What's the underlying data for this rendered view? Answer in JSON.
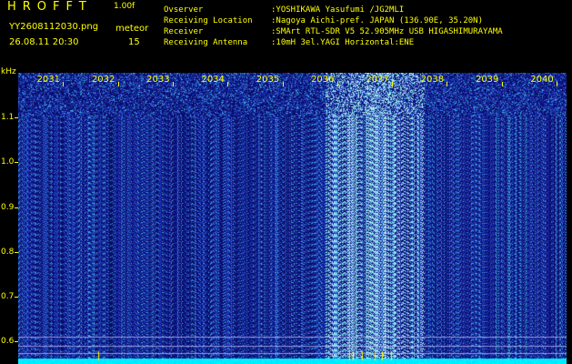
{
  "header": {
    "app_title": "HROFFT",
    "version": "1.00f",
    "filename": "YY2608112030.png",
    "mode": "meteor",
    "datetime": "26.08.11 20:30",
    "count": "15"
  },
  "info": [
    {
      "key": "Ovserver",
      "value": ":YOSHIKAWA Yasufumi /JG2MLI"
    },
    {
      "key": "Receiving Location",
      "value": ":Nagoya Aichi-pref. JAPAN (136.90E, 35.20N)"
    },
    {
      "key": "Receiver",
      "value": ":SMArt RTL-SDR V5 52.905MHz USB HIGASHIMURAYAMA"
    },
    {
      "key": "Receiving Antenna",
      "value": ":10mH 3el.YAGI Horizontal:ENE"
    }
  ],
  "colors": {
    "text": "#ffff00",
    "background": "#000000",
    "noise_base": "#1a1f8c",
    "baseline": "#00ffff"
  },
  "chart_data": {
    "type": "heatmap",
    "y_unit_label": "kHz",
    "x_tick_labels": [
      "2031",
      "2032",
      "2033",
      "2034",
      "2035",
      "2036",
      "2037",
      "2038",
      "2039",
      "2040"
    ],
    "y_tick_labels": [
      "1.1",
      "1.0",
      "0.9",
      "0.8",
      "0.7",
      "0.6"
    ],
    "x_range": [
      2030,
      2040
    ],
    "y_range_khz": [
      0.55,
      1.2
    ],
    "meteor_echo_minute_range": [
      2035.6,
      2037.4
    ],
    "grid": false
  }
}
